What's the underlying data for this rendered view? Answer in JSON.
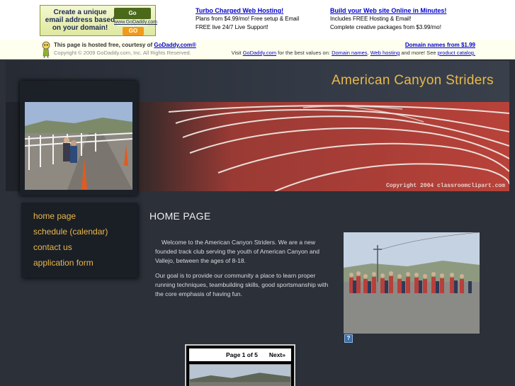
{
  "ad": {
    "box_text": "Create a unique email address based on your domain!",
    "logo": "Go Daddy.com",
    "logo_url": "www.GoDaddy.com",
    "go": "GO",
    "col1": {
      "heading": "Turbo Charged Web Hosting!",
      "line1": "Plans from $4.99/mo! Free setup & Email",
      "line2": "FREE live 24/7 Live Support!"
    },
    "col2": {
      "heading": "Build your Web site Online in Minutes!",
      "line1": "Includes FREE Hosting & Email!",
      "line2": "Complete creative packages from $3.99/mo!"
    },
    "strip": {
      "hosted_prefix": "This page is hosted free, courtesy of ",
      "hosted_link": "GoDaddy.com®",
      "copyright": "Copyright © 2009 GoDaddy.com, Inc. All Rights Reserved.",
      "domain_link": "Domain names from $1.99",
      "visit_prefix": "Visit ",
      "visit_link": "GoDaddy.com",
      "visit_mid": " for the best values on: ",
      "link_domain": "Domain names",
      "sep": ", ",
      "link_hosting": "Web hosting",
      "visit_and": " and more! See ",
      "link_catalog": "product catalog."
    }
  },
  "site": {
    "title": "American Canyon Striders",
    "banner_copyright": "Copyright 2004 classroomclipart.com",
    "nav": [
      {
        "label": "home page"
      },
      {
        "label": "schedule (calendar)"
      },
      {
        "label": "contact us"
      },
      {
        "label": "application form"
      }
    ],
    "page_heading": "HOME PAGE",
    "para1": "Welcome to the American Canyon Striders.  We are a new founded track club serving the youth of American Canyon and Vallejo, between the ages of 8-18.",
    "para2": "Our goal is to provide our community a place to learn proper running techniques, teambuilding skills,  good sportsmanship with the core emphasis of having fun.",
    "help_icon": "?",
    "slideshow": {
      "page": "Page 1 of 5",
      "next": "Next»"
    }
  },
  "colors": {
    "accent": "#e9b84a",
    "background": "#2b3039",
    "nav_bg": "#1a1e25",
    "link": "#0000cc"
  }
}
